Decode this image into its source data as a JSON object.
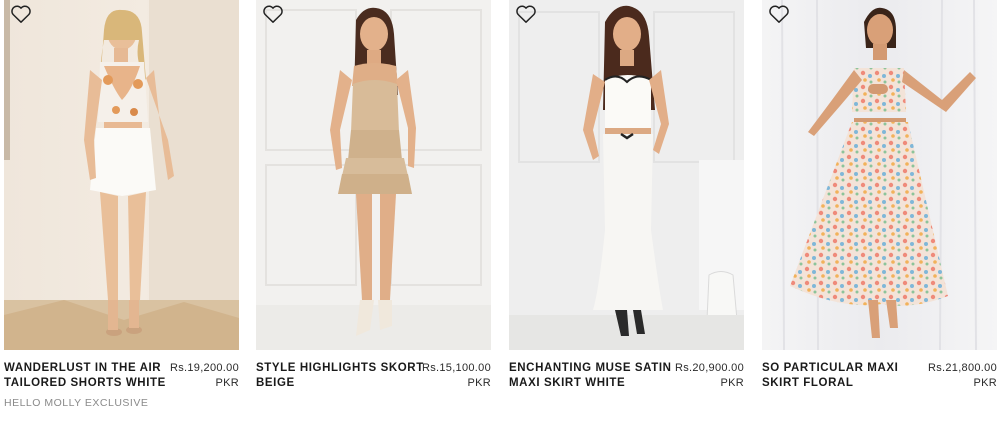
{
  "products": [
    {
      "name_line1": "WANDERLUST IN THE AIR",
      "name_line2": "TAILORED SHORTS WHITE",
      "price_amount": "Rs.19,200.00",
      "price_currency": "PKR",
      "tag": "HELLO MOLLY EXCLUSIVE",
      "wishlist_icon": "heart-outline-icon"
    },
    {
      "name_line1": "STYLE HIGHLIGHTS SKORT",
      "name_line2": "BEIGE",
      "price_amount": "Rs.15,100.00",
      "price_currency": "PKR",
      "wishlist_icon": "heart-outline-icon"
    },
    {
      "name_line1": "ENCHANTING MUSE SATIN",
      "name_line2": "MAXI SKIRT WHITE",
      "price_amount": "Rs.20,900.00",
      "price_currency": "PKR",
      "wishlist_icon": "heart-outline-icon"
    },
    {
      "name_line1": "SO PARTICULAR MAXI",
      "name_line2": "SKIRT FLORAL",
      "price_amount": "Rs.21,800.00",
      "price_currency": "PKR",
      "wishlist_icon": "heart-outline-icon"
    }
  ],
  "colors": {
    "text": "#1a1a1a",
    "muted": "#8a8a8a",
    "background": "#ffffff"
  }
}
